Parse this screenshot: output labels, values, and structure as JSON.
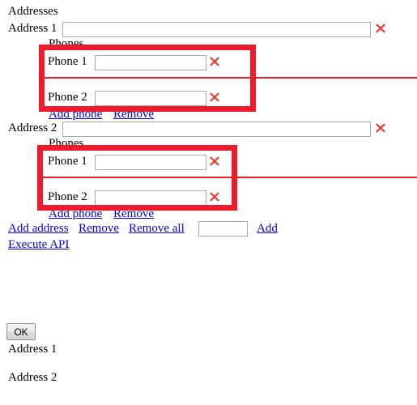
{
  "form": {
    "heading": "Addresses",
    "addresses": [
      {
        "label": "Address 1",
        "value": "",
        "delete_icon": "red-x-icon",
        "phones_heading": "Phones",
        "phones": [
          {
            "label": "Phone 1",
            "value": "",
            "delete_icon": "red-x-icon"
          },
          {
            "label": "Phone 2",
            "value": "",
            "delete_icon": "red-x-icon"
          }
        ],
        "add_phone_link": "Add phone",
        "remove_phone_link": "Remove"
      },
      {
        "label": "Address 2",
        "value": "",
        "delete_icon": "red-x-icon",
        "phones_heading": "Phones",
        "phones": [
          {
            "label": "Phone 1",
            "value": "",
            "delete_icon": "red-x-icon"
          },
          {
            "label": "Phone 2",
            "value": "",
            "delete_icon": "red-x-icon"
          }
        ],
        "add_phone_link": "Add phone",
        "remove_phone_link": "Remove"
      }
    ],
    "actions": {
      "add_address": "Add address",
      "remove": "Remove",
      "remove_all": "Remove all",
      "count_value": "",
      "count_placeholder": "",
      "add": "Add",
      "execute_api": "Execute API"
    }
  },
  "result": {
    "ok_button": "OK",
    "lines": [
      "Address 1",
      "Address 2"
    ]
  },
  "annotations": {
    "highlight_color": "#ed1b2b",
    "x_icon_color": "#e8423a",
    "link_color": "#0000ee",
    "boxes": [
      {
        "name": "phones-group-1-highlight"
      },
      {
        "name": "phones-group-2-highlight"
      }
    ],
    "lines": [
      {
        "name": "phone-separator-rule-1"
      },
      {
        "name": "phone-separator-rule-2"
      }
    ]
  }
}
